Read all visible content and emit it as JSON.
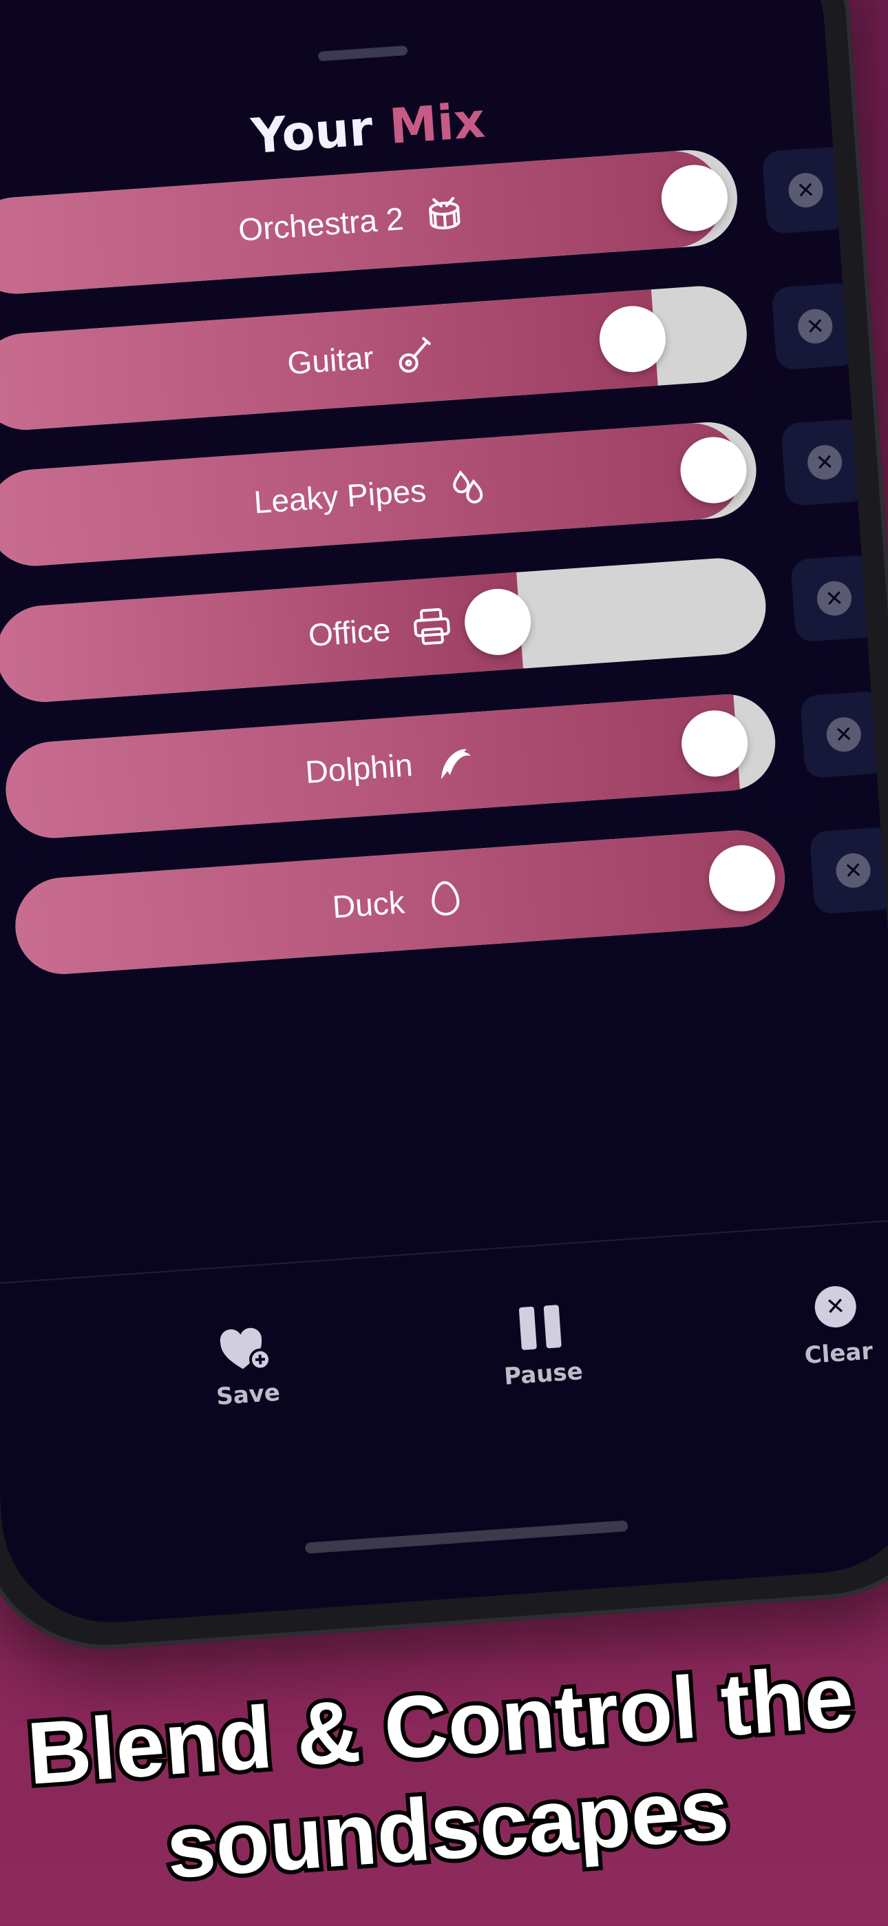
{
  "screen": {
    "title_main": "Your",
    "title_accent": "Mix"
  },
  "mix": [
    {
      "name": "Orchestra 2",
      "icon": "drum-icon",
      "level": 0.98
    },
    {
      "name": "Guitar",
      "icon": "guitar-icon",
      "level": 0.88
    },
    {
      "name": "Leaky Pipes",
      "icon": "drops-icon",
      "level": 0.98
    },
    {
      "name": "Office",
      "icon": "printer-icon",
      "level": 0.68
    },
    {
      "name": "Dolphin",
      "icon": "dolphin-icon",
      "level": 0.95
    },
    {
      "name": "Duck",
      "icon": "egg-icon",
      "level": 1.0
    }
  ],
  "tabbar": {
    "save": "Save",
    "pause": "Pause",
    "clear": "Clear"
  },
  "headline": {
    "line1": "Blend & Control the",
    "line2": "soundscapes"
  },
  "colors": {
    "accent": "#c75b86",
    "slider_track": "#d4d4d4",
    "screen_bg": "#0b0520",
    "page_bg": "#7a1f52"
  }
}
